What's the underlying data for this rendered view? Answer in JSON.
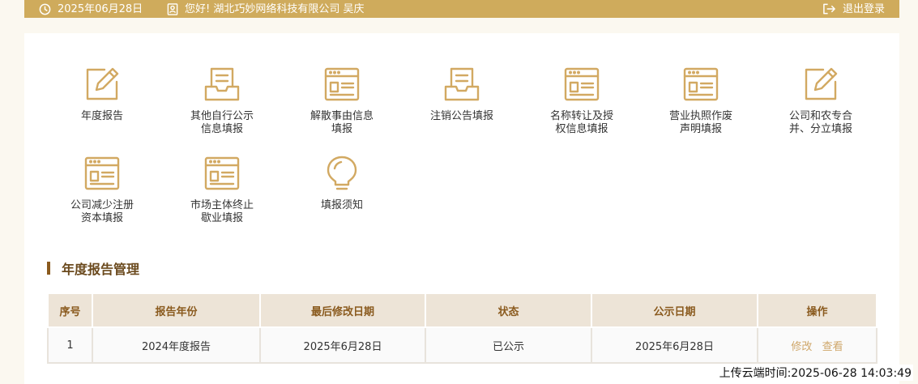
{
  "header": {
    "date": "2025年06月28日",
    "greeting": "您好! 湖北巧妙网络科技有限公司 吴庆",
    "logout": "退出登录"
  },
  "tiles": [
    {
      "line1": "年度报告",
      "line2": "",
      "icon": "edit-icon"
    },
    {
      "line1": "其他自行公示",
      "line2": "信息填报",
      "icon": "inbox-icon"
    },
    {
      "line1": "解散事由信息",
      "line2": "填报",
      "icon": "form-window-icon"
    },
    {
      "line1": "注销公告填报",
      "line2": "",
      "icon": "inbox-icon"
    },
    {
      "line1": "名称转让及授",
      "line2": "权信息填报",
      "icon": "form-window-icon"
    },
    {
      "line1": "营业执照作废",
      "line2": "声明填报",
      "icon": "form-window-icon"
    },
    {
      "line1": "公司和农专合",
      "line2": "并、分立填报",
      "icon": "edit-icon"
    },
    {
      "line1": "公司减少注册",
      "line2": "资本填报",
      "icon": "form-window-icon"
    },
    {
      "line1": "市场主体终止",
      "line2": "歇业填报",
      "icon": "form-window-icon"
    },
    {
      "line1": "填报须知",
      "line2": "",
      "icon": "lightbulb-icon"
    }
  ],
  "section": {
    "title": "年度报告管理"
  },
  "table": {
    "headers": [
      "序号",
      "报告年份",
      "最后修改日期",
      "状态",
      "公示日期",
      "操作"
    ],
    "rows": [
      {
        "seq": "1",
        "year": "2024年度报告",
        "modified": "2025年6月28日",
        "status": "已公示",
        "published": "2025年6月28日",
        "edit": "修改",
        "view": "查看"
      }
    ]
  },
  "footer": {
    "upload_time": "上传云端时间:2025-06-28 14:03:49"
  },
  "colors": {
    "accent": "#cfab5c",
    "icon": "#d2a962",
    "header_bg": "#ede4d7",
    "title": "#6b4a1e"
  }
}
